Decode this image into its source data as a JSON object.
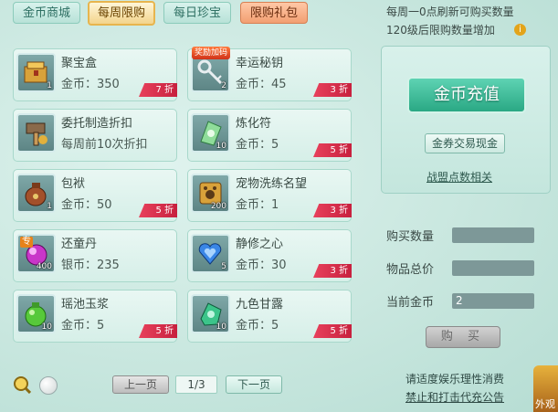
{
  "tabs": [
    {
      "label": "金币商城"
    },
    {
      "label": "每周限购"
    },
    {
      "label": "每日珍宝"
    },
    {
      "label": "限购礼包"
    }
  ],
  "notes": {
    "line1": "每周一0点刷新可购买数量",
    "line2": "120级后限购数量增加"
  },
  "items": [
    {
      "name": "聚宝盒",
      "price": "金币：350",
      "count": "1",
      "discount": "7 折"
    },
    {
      "name": "幸运秘钥",
      "price": "金币：45",
      "count": "2",
      "discount": "3 折",
      "badge": "奖励加码"
    },
    {
      "name": "委托制造折扣",
      "price": "每周前10次折扣",
      "count": ""
    },
    {
      "name": "炼化符",
      "price": "金币：5",
      "count": "10",
      "discount": "5 折"
    },
    {
      "name": "包袱",
      "price": "金币：50",
      "count": "1",
      "discount": "5 折"
    },
    {
      "name": "宠物洗练名望",
      "price": "金币：1",
      "count": "200",
      "discount": "3 折"
    },
    {
      "name": "还童丹",
      "price": "银币：235",
      "count": "400",
      "zhuan": "专"
    },
    {
      "name": "静修之心",
      "price": "金币：30",
      "count": "5",
      "discount": "3 折"
    },
    {
      "name": "瑶池玉浆",
      "price": "金币：5",
      "count": "10",
      "discount": "5 折"
    },
    {
      "name": "九色甘露",
      "price": "金币：5",
      "count": "10",
      "discount": "5 折"
    }
  ],
  "panel": {
    "recharge": "金币充值",
    "exchange": "金券交易现金",
    "alliance": "战盟点数相关"
  },
  "fields": {
    "qty_label": "购买数量",
    "qty_value": "",
    "total_label": "物品总价",
    "total_value": "",
    "current_label": "当前金币",
    "current_value": "2"
  },
  "buy_label": "购 买",
  "pagination": {
    "prev": "上一页",
    "page": "1/3",
    "next": "下一页"
  },
  "footer": {
    "line1": "请适度娱乐理性消费",
    "line2": "禁止和打击代充公告",
    "corner": "外观"
  },
  "colors": {
    "accent": "#2aa884",
    "discount": "#d42a47"
  }
}
